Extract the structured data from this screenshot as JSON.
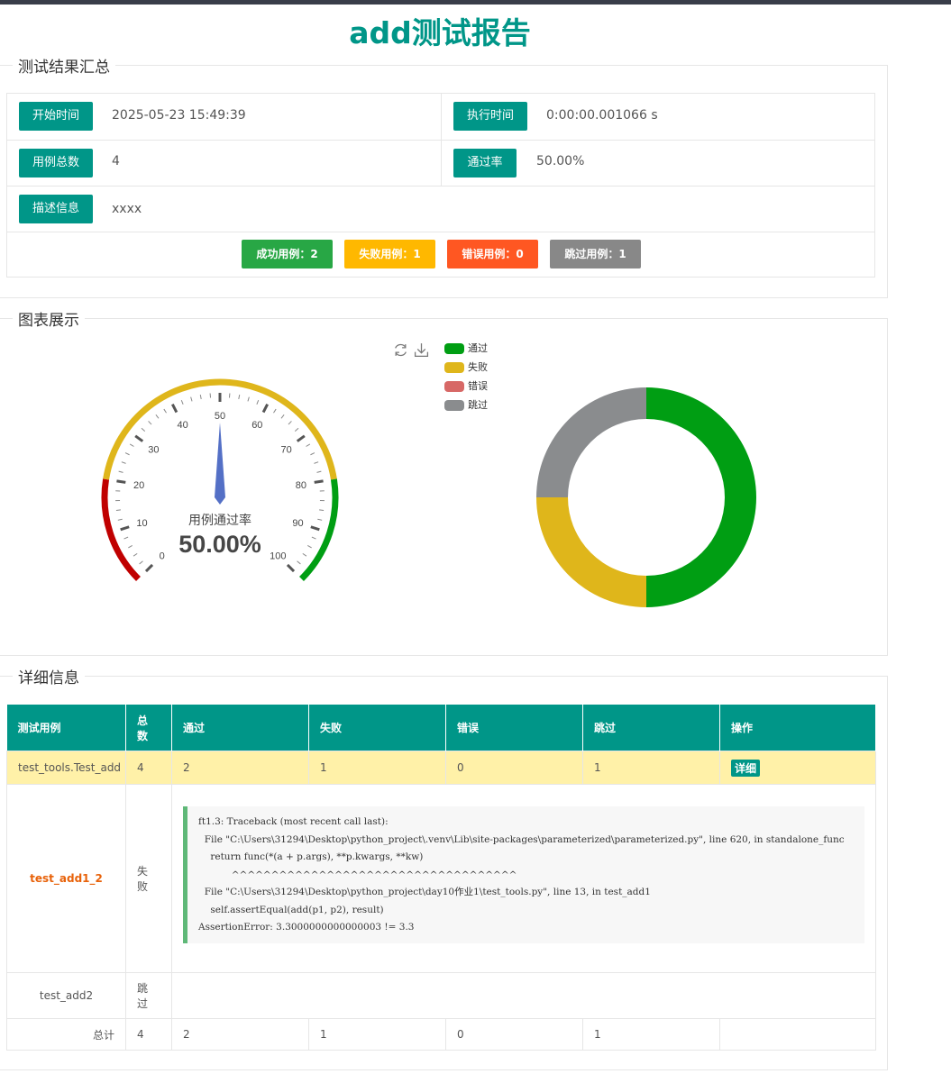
{
  "title": "add测试报告",
  "summary": {
    "legend": "测试结果汇总",
    "start_label": "开始时间",
    "start_value": "2025-05-23 15:49:39",
    "exec_label": "执行时间",
    "exec_value": "0:00:00.001066 s",
    "total_label": "用例总数",
    "total_value": "4",
    "pass_rate_label": "通过率",
    "pass_rate_value": "50.00%",
    "desc_label": "描述信息",
    "desc_value": "xxxx",
    "success_count": "成功用例：2",
    "fail_count": "失败用例：1",
    "error_count": "错误用例：0",
    "skip_count": "跳过用例：1"
  },
  "charts_legend": "图表展示",
  "details_legend": "详细信息",
  "colors": {
    "accent": "#009688",
    "pass": "#009e13",
    "fail": "#dfb61b",
    "error": "#d76866",
    "skip": "#8a8c8e",
    "success_btn": "#28a745",
    "fail_btn": "#ffb800",
    "error_btn": "#ff5722",
    "skip_btn": "#888888"
  },
  "icons": {
    "refresh": "refresh-icon",
    "download": "download-icon"
  },
  "chart_data": [
    {
      "type": "gauge",
      "title": "用例通过率",
      "value": 50.0,
      "value_label": "50.00%",
      "min": 0,
      "max": 100,
      "tick_labels": [
        "0",
        "10",
        "20",
        "30",
        "40",
        "50",
        "60",
        "70",
        "80",
        "90",
        "100"
      ],
      "bands": [
        {
          "to": 20,
          "color": "#c00000"
        },
        {
          "to": 80,
          "color": "#dfb61b"
        },
        {
          "to": 100,
          "color": "#009e13"
        }
      ]
    },
    {
      "type": "pie",
      "legend_placement": "top-center",
      "slices": [
        {
          "name": "通过",
          "value": 2,
          "color": "#009e13"
        },
        {
          "name": "失败",
          "value": 1,
          "color": "#dfb61b"
        },
        {
          "name": "错误",
          "value": 0,
          "color": "#d76866"
        },
        {
          "name": "跳过",
          "value": 1,
          "color": "#8a8c8e"
        }
      ]
    }
  ],
  "table": {
    "headers": [
      "测试用例",
      "总数",
      "通过",
      "失败",
      "错误",
      "跳过",
      "操作"
    ],
    "class_row": {
      "name": "test_tools.Test_add",
      "total": "4",
      "pass": "2",
      "fail": "1",
      "error": "0",
      "skip": "1",
      "action": "详细"
    },
    "cases": [
      {
        "name": "test_add1_2",
        "status": "失败",
        "trace": "ft1.3: Traceback (most recent call last):\n  File \"C:\\Users\\31294\\Desktop\\python_project\\.venv\\Lib\\site-packages\\parameterized\\parameterized.py\", line 620, in standalone_func\n    return func(*(a + p.args), **p.kwargs, **kw)\n           ^^^^^^^^^^^^^^^^^^^^^^^^^^^^^^^^^^^^\n  File \"C:\\Users\\31294\\Desktop\\python_project\\day10作业1\\test_tools.py\", line 13, in test_add1\n    self.assertEqual(add(p1, p2), result)\nAssertionError: 3.3000000000000003 != 3.3"
      },
      {
        "name": "test_add2",
        "status": "跳过"
      }
    ],
    "total_row": {
      "label": "总计",
      "total": "4",
      "pass": "2",
      "fail": "1",
      "error": "0",
      "skip": "1"
    }
  }
}
